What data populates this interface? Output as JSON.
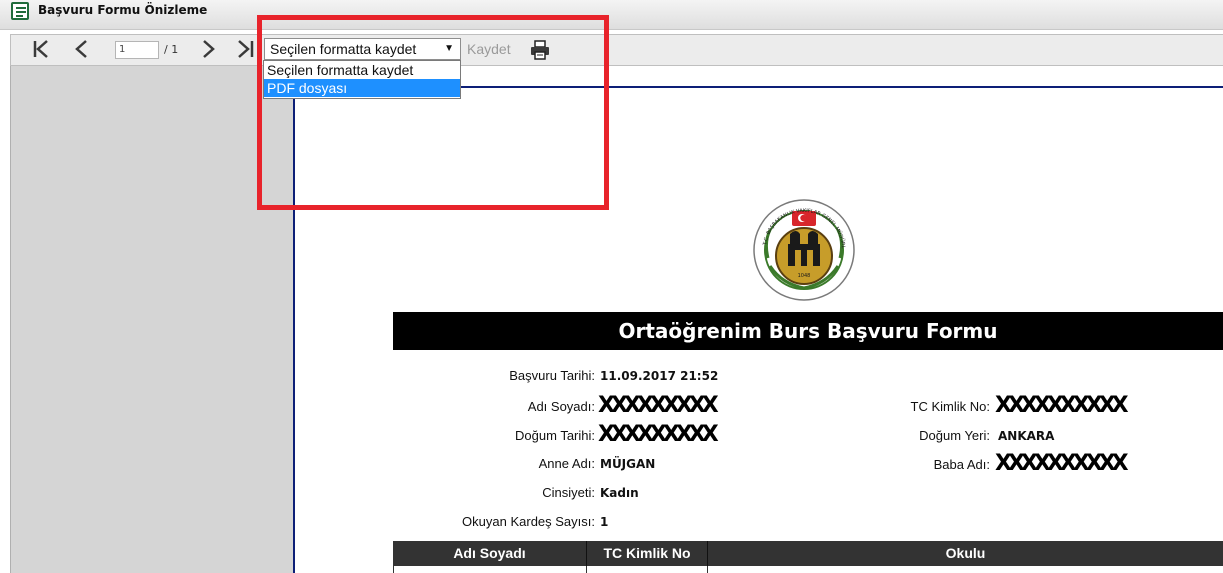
{
  "window": {
    "title": "Başvuru Formu Önizleme",
    "title_icon": "form-icon"
  },
  "toolbar": {
    "first_page_icon": "first-page-icon",
    "prev_page_icon": "prev-page-icon",
    "next_page_icon": "next-page-icon",
    "last_page_icon": "last-page-icon",
    "page_current": "1",
    "page_total": "/ 1",
    "format_select_value": "Seçilen formatta kaydet",
    "save_label": "Kaydet",
    "print_icon": "print-icon"
  },
  "format_dropdown": {
    "options": [
      {
        "label": "Seçilen formatta kaydet",
        "selected": false
      },
      {
        "label": "PDF dosyası",
        "selected": true
      }
    ]
  },
  "annotation": {
    "color": "#e8232b"
  },
  "document": {
    "logo_name": "vakiflar-genel-mudurlugu-seal",
    "logo_text": "T.C. BAŞBAKANLIK VAKIFLAR GENEL MÜDÜRLÜĞÜ",
    "logo_year": "1048",
    "form_title": "Ortaöğrenim Burs Başvuru Formu",
    "fields": {
      "basvuru_tarihi_label": "Başvuru Tarihi:",
      "basvuru_tarihi_value": "11.09.2017 21:52",
      "adi_soyadi_label": "Adı Soyadı:",
      "adi_soyadi_value": "XXXXXXXXX",
      "tc_kimlik_label": "TC Kimlik No:",
      "tc_kimlik_value": "XXXXXXXXXX",
      "dogum_tarihi_label": "Doğum Tarihi:",
      "dogum_tarihi_value": "XXXXXXXXX",
      "dogum_yeri_label": "Doğum Yeri:",
      "dogum_yeri_value": "ANKARA",
      "anne_adi_label": "Anne Adı:",
      "anne_adi_value": "MÜJGAN",
      "baba_adi_label": "Baba Adı:",
      "baba_adi_value": "XXXXXXXXXX",
      "cinsiyeti_label": "Cinsiyeti:",
      "cinsiyeti_value": "Kadın",
      "kardes_label": "Okuyan Kardeş Sayısı:",
      "kardes_value": "1"
    },
    "table": {
      "headers": [
        "Adı Soyadı",
        "TC Kimlik No",
        "Okulu"
      ]
    }
  }
}
